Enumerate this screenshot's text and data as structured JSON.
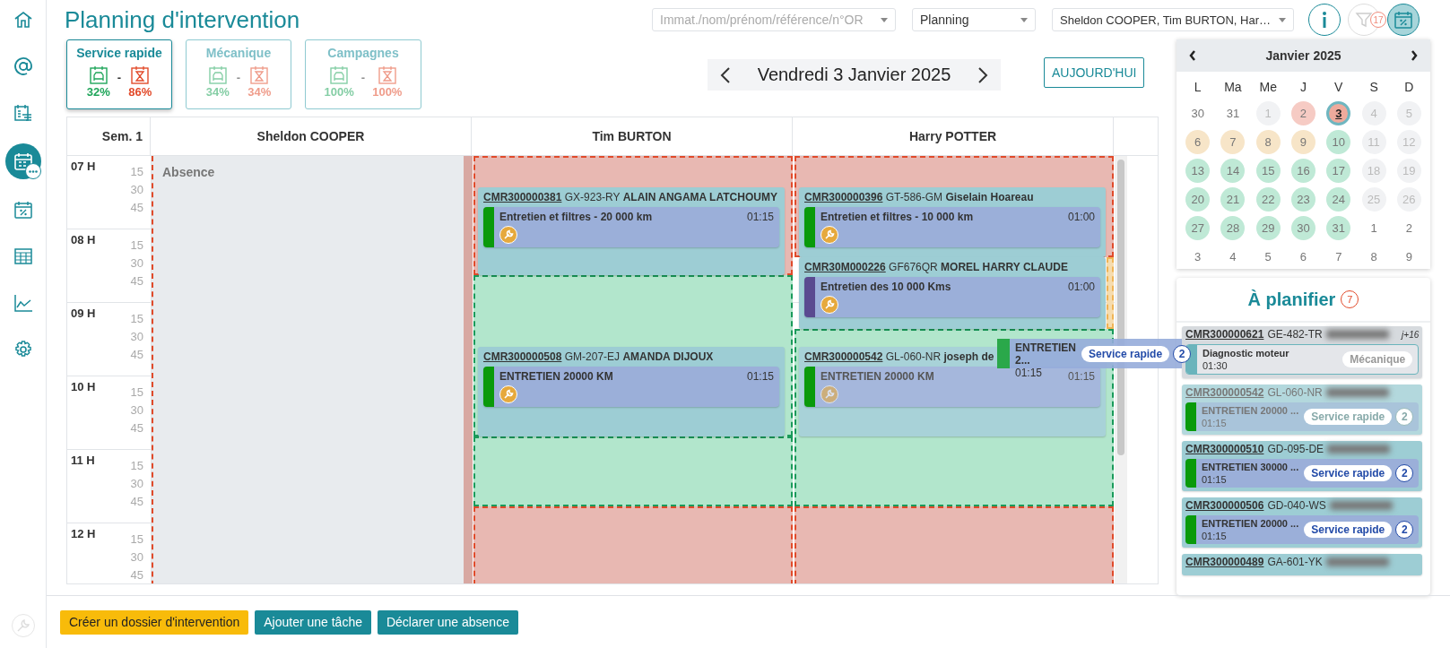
{
  "sidebar": {
    "items": [
      {
        "selected": false
      },
      {
        "selected": false
      },
      {
        "selected": false
      },
      {
        "selected": true
      },
      {
        "selected": false
      },
      {
        "selected": false
      },
      {
        "selected": false
      },
      {
        "selected": false
      }
    ],
    "bottom_item": {
      "disabled": true
    }
  },
  "title": "Planning d'intervention",
  "search": {
    "placeholder": "Immat./nom/prénom/référence/n°OR"
  },
  "view_select": {
    "value": "Planning"
  },
  "mechanics_select": {
    "value": "Sheldon COOPER, Tim BURTON, Har…"
  },
  "toolbar": [
    {
      "selected": false,
      "disabled": false
    },
    {
      "selected": false,
      "disabled": true,
      "badge": "17"
    },
    {
      "selected": true,
      "disabled": false
    }
  ],
  "tabs": [
    {
      "label": "Service rapide",
      "selected": true,
      "car_rate": "32%",
      "separator": "-",
      "time_rate": "86%"
    },
    {
      "label": "Mécanique",
      "selected": false,
      "car_rate": "34%",
      "separator": "-",
      "time_rate": "34%"
    },
    {
      "label": "Campagnes",
      "selected": false,
      "car_rate": "100%",
      "separator": "-",
      "time_rate": "100%"
    }
  ],
  "date_nav": {
    "date": "Vendredi 3 Janvier 2025",
    "today_button": "AUJOURD'HUI"
  },
  "planning": {
    "week_label": "Sem. 1",
    "hours": [
      {
        "label": "07 H",
        "quarters": [
          "15",
          "30",
          "45"
        ]
      },
      {
        "label": "08 H",
        "quarters": [
          "15",
          "30",
          "45"
        ]
      },
      {
        "label": "09 H",
        "quarters": [
          "15",
          "30",
          "45"
        ]
      },
      {
        "label": "10 H",
        "quarters": [
          "15",
          "30",
          "45"
        ]
      },
      {
        "label": "11 H",
        "quarters": [
          "15",
          "30",
          "45"
        ]
      },
      {
        "label": "12 H",
        "quarters": [
          "15",
          "30",
          "45"
        ]
      }
    ],
    "columns": [
      {
        "name": "Sheldon COOPER",
        "blocks": [
          {
            "kind": "absence",
            "label": "Absence"
          }
        ]
      },
      {
        "name": "Tim BURTON",
        "blocks": [
          {
            "kind": "unavailable"
          },
          {
            "kind": "appointment",
            "reference": "CMR300000381",
            "plate": "GX-923-RY",
            "customer": "ALAIN ANGAMA LATCHOUMY",
            "dragging": false,
            "task": {
              "title": "Entretien et filtres - 20 000 km",
              "duration": "01:15",
              "color": "#0a9a0a"
            }
          },
          {
            "kind": "available"
          },
          {
            "kind": "appointment",
            "reference": "CMR300000508",
            "plate": "GM-207-EJ",
            "customer": "AMANDA DIJOUX",
            "dragging": false,
            "task": {
              "title": "ENTRETIEN 20000 KM",
              "duration": "01:15",
              "color": "#0a9a0a"
            }
          },
          {
            "kind": "available"
          },
          {
            "kind": "unavailable"
          }
        ]
      },
      {
        "name": "Harry POTTER",
        "blocks": [
          {
            "kind": "unavailable"
          },
          {
            "kind": "appointment",
            "reference": "CMR300000396",
            "plate": "GT-586-GM",
            "customer": "Giselain Hoareau",
            "dragging": false,
            "task": {
              "title": "Entretien et filtres - 10 000 km",
              "duration": "01:00",
              "color": "#0a9a0a"
            }
          },
          {
            "kind": "partial"
          },
          {
            "kind": "appointment",
            "reference": "CMR30M000226",
            "plate": "GF676QR",
            "customer": "MOREL HARRY CLAUDE",
            "dragging": false,
            "task": {
              "title": "Entretien des 10 000 Kms",
              "duration": "01:00",
              "color": "#5a4a90"
            }
          },
          {
            "kind": "available"
          },
          {
            "kind": "appointment",
            "reference": "CMR300000542",
            "plate": "GL-060-NR",
            "customer": "joseph de",
            "dragging": true,
            "task": {
              "title": "ENTRETIEN 20000 KM",
              "duration": "01:15",
              "color": "#0a9a0a"
            }
          },
          {
            "kind": "unavailable"
          }
        ]
      }
    ]
  },
  "drag_preview": {
    "title": "ENTRETIEN 2...",
    "duration": "01:15",
    "tag": "Service rapide",
    "count": "2",
    "color": "#2aa84a"
  },
  "calendar": {
    "month": "Janvier 2025",
    "weekdays": [
      "L",
      "Ma",
      "Me",
      "J",
      "V",
      "S",
      "D"
    ],
    "days": [
      {
        "label": "30",
        "kind": "outside",
        "selected": false
      },
      {
        "label": "31",
        "kind": "outside",
        "selected": false
      },
      {
        "label": "1",
        "kind": "closed",
        "selected": false
      },
      {
        "label": "2",
        "kind": "absent",
        "selected": false
      },
      {
        "label": "3",
        "kind": "absent",
        "selected": true
      },
      {
        "label": "4",
        "kind": "closed",
        "selected": false
      },
      {
        "label": "5",
        "kind": "closed",
        "selected": false
      },
      {
        "label": "6",
        "kind": "partial",
        "selected": false
      },
      {
        "label": "7",
        "kind": "partial",
        "selected": false
      },
      {
        "label": "8",
        "kind": "partial",
        "selected": false
      },
      {
        "label": "9",
        "kind": "partial",
        "selected": false
      },
      {
        "label": "10",
        "kind": "available",
        "selected": false
      },
      {
        "label": "11",
        "kind": "closed",
        "selected": false
      },
      {
        "label": "12",
        "kind": "closed",
        "selected": false
      },
      {
        "label": "13",
        "kind": "available",
        "selected": false
      },
      {
        "label": "14",
        "kind": "available",
        "selected": false
      },
      {
        "label": "15",
        "kind": "available",
        "selected": false
      },
      {
        "label": "16",
        "kind": "available",
        "selected": false
      },
      {
        "label": "17",
        "kind": "available",
        "selected": false
      },
      {
        "label": "18",
        "kind": "closed",
        "selected": false
      },
      {
        "label": "19",
        "kind": "closed",
        "selected": false
      },
      {
        "label": "20",
        "kind": "available",
        "selected": false
      },
      {
        "label": "21",
        "kind": "available",
        "selected": false
      },
      {
        "label": "22",
        "kind": "available",
        "selected": false
      },
      {
        "label": "23",
        "kind": "available",
        "selected": false
      },
      {
        "label": "24",
        "kind": "available",
        "selected": false
      },
      {
        "label": "25",
        "kind": "closed",
        "selected": false
      },
      {
        "label": "26",
        "kind": "closed",
        "selected": false
      },
      {
        "label": "27",
        "kind": "available",
        "selected": false
      },
      {
        "label": "28",
        "kind": "available",
        "selected": false
      },
      {
        "label": "29",
        "kind": "available",
        "selected": false
      },
      {
        "label": "30",
        "kind": "available",
        "selected": false
      },
      {
        "label": "31",
        "kind": "available",
        "selected": false
      },
      {
        "label": "1",
        "kind": "outside",
        "selected": false
      },
      {
        "label": "2",
        "kind": "outside",
        "selected": false
      },
      {
        "label": "3",
        "kind": "outside",
        "selected": false
      },
      {
        "label": "4",
        "kind": "outside",
        "selected": false
      },
      {
        "label": "5",
        "kind": "outside",
        "selected": false
      },
      {
        "label": "6",
        "kind": "outside",
        "selected": false
      },
      {
        "label": "7",
        "kind": "outside",
        "selected": false
      },
      {
        "label": "8",
        "kind": "outside",
        "selected": false
      },
      {
        "label": "9",
        "kind": "outside",
        "selected": false
      }
    ]
  },
  "to_plan": {
    "title": "À planifier",
    "count": "7",
    "items": [
      {
        "reference": "CMR300000621",
        "plate": "GE-482-TR",
        "delay": "j+16",
        "active": false,
        "dragging": false,
        "task": {
          "title": "Diagnostic moteur",
          "duration": "01:30",
          "tag": "Mécanique",
          "color": "#6ab4bc"
        }
      },
      {
        "reference": "CMR300000542",
        "plate": "GL-060-NR",
        "active": true,
        "dragging": true,
        "task": {
          "title": "ENTRETIEN 20000 ...",
          "duration": "01:15",
          "tag": "Service rapide",
          "count": "2",
          "color": "#0a9a0a"
        }
      },
      {
        "reference": "CMR300000510",
        "plate": "GD-095-DE",
        "active": true,
        "dragging": false,
        "task": {
          "title": "ENTRETIEN 30000 ...",
          "duration": "01:15",
          "tag": "Service rapide",
          "count": "2",
          "color": "#0a9a0a"
        }
      },
      {
        "reference": "CMR300000506",
        "plate": "GD-040-WS",
        "active": true,
        "dragging": false,
        "task": {
          "title": "ENTRETIEN 20000 ...",
          "duration": "01:15",
          "tag": "Service rapide",
          "count": "2",
          "color": "#0a9a0a"
        }
      },
      {
        "reference": "CMR300000489",
        "plate": "GA-601-YK"
      }
    ]
  },
  "footer_buttons": [
    {
      "label": "Créer un dossier d'intervention",
      "kind": "warning"
    },
    {
      "label": "Ajouter une tâche",
      "kind": "primary"
    },
    {
      "label": "Déclarer une absence",
      "kind": "primary"
    }
  ]
}
